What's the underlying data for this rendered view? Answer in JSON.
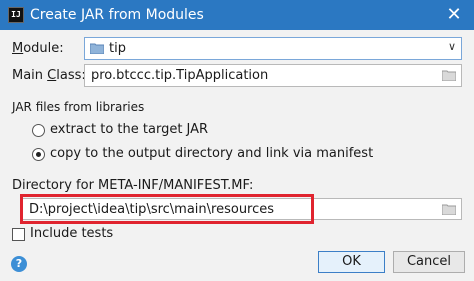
{
  "window": {
    "title": "Create JAR from Modules",
    "app_icon_text": "IJ"
  },
  "module": {
    "label": "Module:",
    "value": "tip"
  },
  "main_class": {
    "label": "Main Class:",
    "value": "pro.btccc.tip.TipApplication"
  },
  "jar_files": {
    "section_label": "JAR files from libraries",
    "options": [
      {
        "label": "extract to the target JAR",
        "selected": false
      },
      {
        "label": "copy to the output directory and link via manifest",
        "selected": true
      }
    ]
  },
  "manifest_dir": {
    "label": "Directory for META-INF/MANIFEST.MF:",
    "value": "D:\\project\\idea\\tip\\src\\main\\resources"
  },
  "include_tests": {
    "label": "Include tests",
    "checked": false
  },
  "buttons": {
    "ok": "OK",
    "cancel": "Cancel"
  },
  "help": {
    "glyph": "?"
  },
  "colors": {
    "titlebar": "#2b78c2",
    "highlight": "#e0242f",
    "help": "#3d8fd6"
  }
}
